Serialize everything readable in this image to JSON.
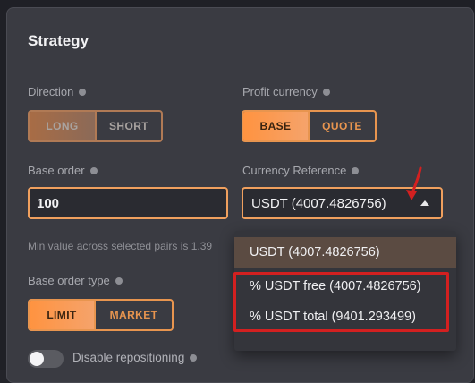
{
  "section": {
    "title": "Strategy"
  },
  "direction": {
    "label": "Direction",
    "options": [
      "LONG",
      "SHORT"
    ],
    "selected": "LONG"
  },
  "profit_currency": {
    "label": "Profit currency",
    "options": [
      "BASE",
      "QUOTE"
    ],
    "selected": "BASE"
  },
  "base_order": {
    "label": "Base order",
    "value": "100",
    "hint": "Min value across selected pairs is 1.39"
  },
  "currency_reference": {
    "label": "Currency Reference",
    "value": "USDT (4007.4826756)",
    "options": [
      "USDT (4007.4826756)",
      "% USDT free (4007.4826756)",
      "% USDT total (9401.293499)"
    ],
    "selected_index": 0
  },
  "base_order_type": {
    "label": "Base order type",
    "options": [
      "LIMIT",
      "MARKET"
    ],
    "selected": "LIMIT"
  },
  "repositioning": {
    "label": "Disable repositioning",
    "enabled": false
  },
  "colors": {
    "accent": "#e8954f",
    "highlight_annotation": "#d32020",
    "panel_bg": "#3a3b42"
  },
  "icons": {
    "info": "info-icon",
    "caret": "caret-up-icon",
    "annotation_arrow": "arrow-icon"
  }
}
